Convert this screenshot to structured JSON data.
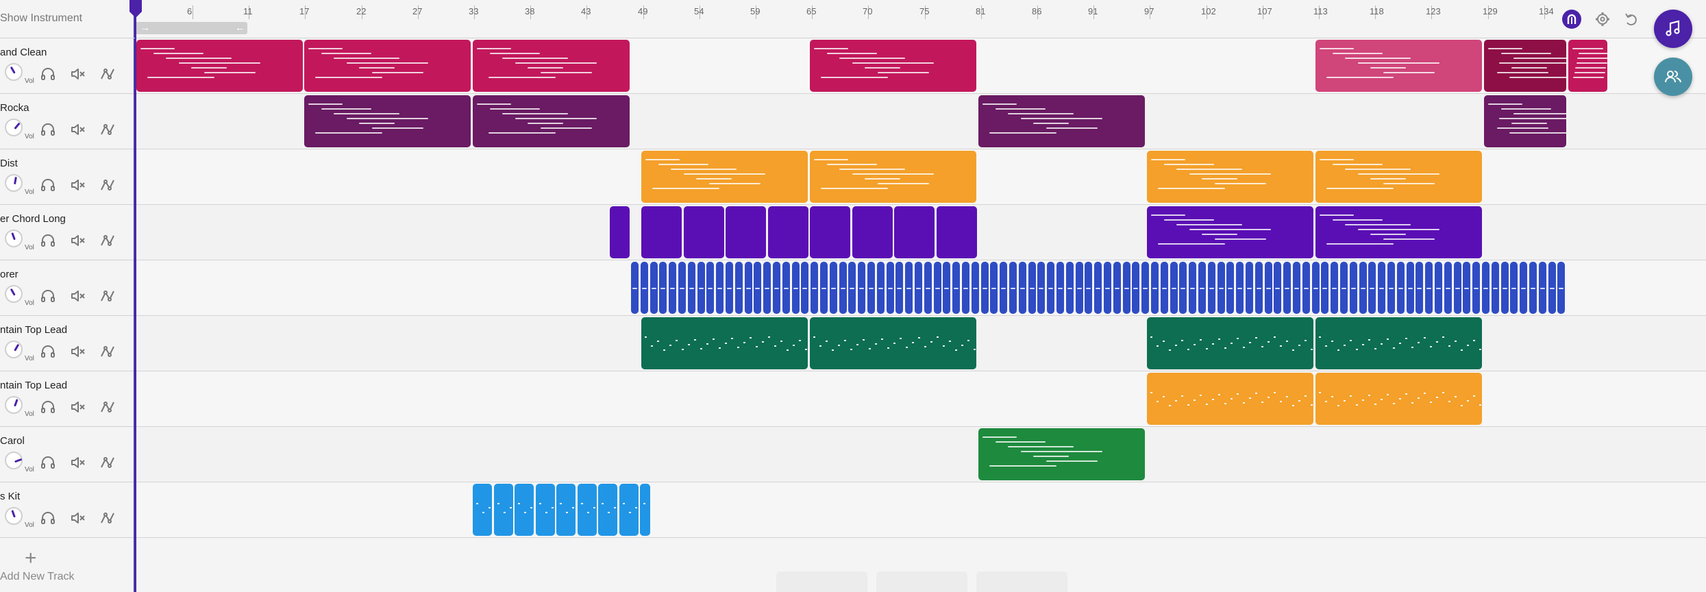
{
  "header": {
    "show_instrument": "Show Instrument"
  },
  "ruler": {
    "bar_labels": [
      "6",
      "11",
      "17",
      "22",
      "27",
      "33",
      "38",
      "43",
      "49",
      "54",
      "59",
      "65",
      "70",
      "75",
      "81",
      "86",
      "91",
      "97",
      "102",
      "107",
      "113",
      "118",
      "123",
      "129",
      "134"
    ]
  },
  "tracks": [
    {
      "name": "and Clean",
      "vol_label": "Vol",
      "color": "#c2185b"
    },
    {
      "name": "Rocka",
      "vol_label": "Vol",
      "color": "#6a1b63"
    },
    {
      "name": "Dist",
      "vol_label": "Vol",
      "color": "#f4a02a"
    },
    {
      "name": "er Chord Long",
      "vol_label": "Vol",
      "color": "#5a0fb4"
    },
    {
      "name": "orer",
      "vol_label": "Vol",
      "color": "#2f4cc4"
    },
    {
      "name": "ntain Top Lead",
      "vol_label": "Vol",
      "color": "#0d6e52"
    },
    {
      "name": "ntain Top Lead",
      "vol_label": "Vol",
      "color": "#f4a02a"
    },
    {
      "name": "Carol",
      "vol_label": "Vol",
      "color": "#1e8a3e"
    },
    {
      "name": "s Kit",
      "vol_label": "Vol",
      "color": "#2196e6"
    }
  ],
  "add_track": {
    "plus": "+",
    "label": "Add New Track"
  },
  "icons": {
    "headphones": "headphones-icon",
    "mute": "mute-icon",
    "automation": "automation-icon",
    "metronome": "metronome-icon",
    "settings": "gear-icon",
    "undo": "undo-icon",
    "instrument": "music-note-icon",
    "collab": "collaborators-icon"
  },
  "colors": {
    "accent": "#4b22a8",
    "collab": "#4a90a4"
  }
}
